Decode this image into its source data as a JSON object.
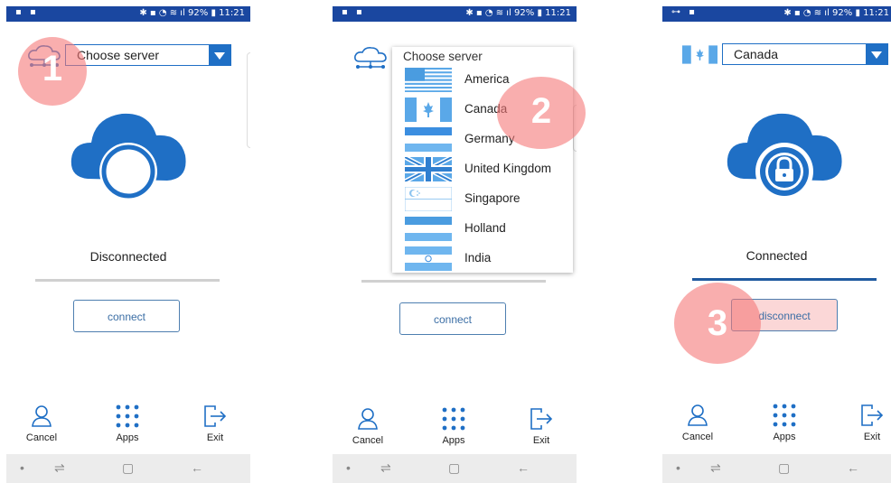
{
  "status_bar": {
    "battery": "92%",
    "time": "11:21",
    "icons": "signal-icons"
  },
  "panels": [
    {
      "server_select": {
        "value": "Choose server"
      },
      "status": "Disconnected",
      "action_button": "connect",
      "step_number": "1"
    },
    {
      "dropdown": {
        "title": "Choose server",
        "options": [
          "America",
          "Canada",
          "Germany",
          "United Kingdom",
          "Singapore",
          "Holland",
          "India"
        ]
      },
      "action_button": "connect",
      "step_number": "2"
    },
    {
      "server_select": {
        "value": "Canada"
      },
      "status": "Connected",
      "action_button": "disconnect",
      "step_number": "3"
    }
  ],
  "bottom_nav": {
    "cancel": "Cancel",
    "apps": "Apps",
    "exit": "Exit"
  },
  "colors": {
    "status_bar": "#1a47a0",
    "accent": "#1f6fc5",
    "marker": "#f57878",
    "connected_line": "#1f5aa0",
    "disconnected_line": "#cfcfcf"
  }
}
